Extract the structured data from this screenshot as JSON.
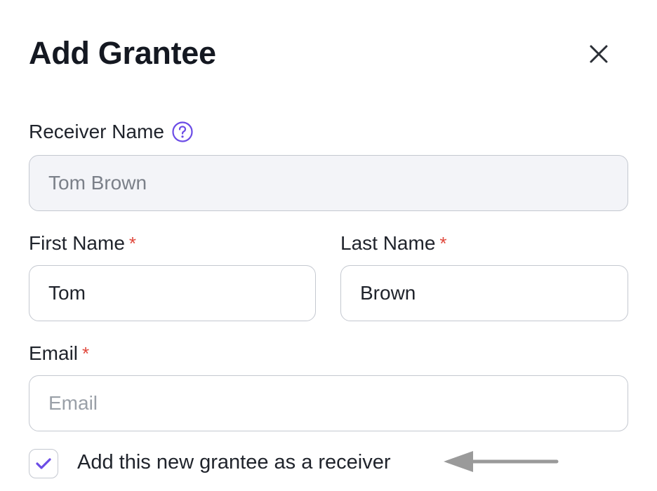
{
  "dialog": {
    "title": "Add Grantee",
    "close_icon": "close-icon"
  },
  "form": {
    "receiver_name": {
      "label": "Receiver Name",
      "help_icon": "question-circle-icon",
      "value": "Tom Brown",
      "disabled": true
    },
    "first_name": {
      "label": "First Name",
      "required_marker": "*",
      "value": "Tom"
    },
    "last_name": {
      "label": "Last Name",
      "required_marker": "*",
      "value": "Brown"
    },
    "email": {
      "label": "Email",
      "required_marker": "*",
      "value": "",
      "placeholder": "Email"
    },
    "add_as_receiver": {
      "label": "Add this new grantee as a receiver",
      "checked": true
    }
  },
  "annotation": {
    "arrow_icon": "arrow-left-icon"
  },
  "colors": {
    "accent": "#6b4ce6",
    "required": "#e0483c",
    "border": "#c4c8d0",
    "disabled_bg": "#f3f4f8",
    "arrow": "#9a9a9a"
  }
}
